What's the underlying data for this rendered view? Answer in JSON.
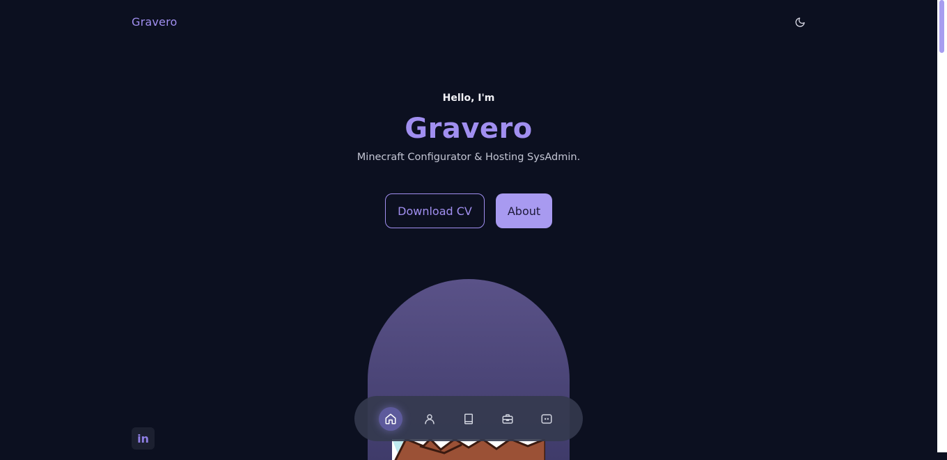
{
  "header": {
    "logo": "Gravero",
    "theme_toggle_icon": "moon-icon"
  },
  "hero": {
    "greeting": "Hello, I'm",
    "name": "Gravero",
    "subtitle": "Minecraft Configurator & Hosting SysAdmin.",
    "primary_button": "Download CV",
    "secondary_button": "About"
  },
  "nav": {
    "items": [
      {
        "icon": "home-icon",
        "active": true
      },
      {
        "icon": "user-icon",
        "active": false
      },
      {
        "icon": "book-icon",
        "active": false
      },
      {
        "icon": "briefcase-icon",
        "active": false
      },
      {
        "icon": "message-icon",
        "active": false
      }
    ]
  },
  "social": {
    "linkedin_label": "in",
    "icon": "linkedin-icon"
  },
  "colors": {
    "background": "#0c1020",
    "accent": "#a18ff0",
    "button_fill": "#a89af0"
  }
}
